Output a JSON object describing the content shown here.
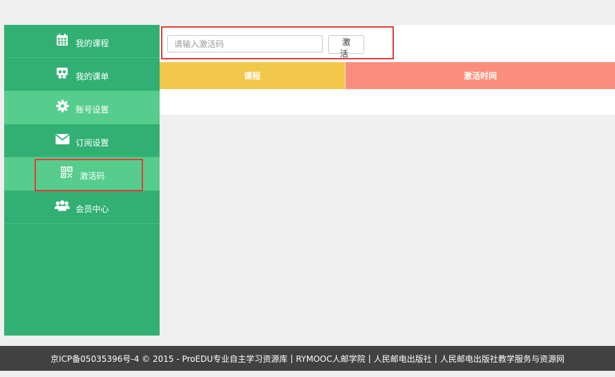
{
  "sidebar": {
    "items": [
      {
        "label": "我的课程",
        "icon": "calendar-icon"
      },
      {
        "label": "我的课单",
        "icon": "course-list-icon"
      },
      {
        "label": "账号设置",
        "icon": "gear-icon"
      },
      {
        "label": "订阅设置",
        "icon": "envelope-icon"
      },
      {
        "label": "激活码",
        "icon": "qrcode-icon"
      },
      {
        "label": "会员中心",
        "icon": "users-icon"
      }
    ]
  },
  "activation": {
    "placeholder": "请输入激活码",
    "value": "",
    "button_label": "激 活"
  },
  "table": {
    "headers": [
      "课程",
      "激活时间"
    ],
    "rows": []
  },
  "footer": {
    "icp": "京ICP备05035396号-4",
    "copyright": "© 2015 - ProEDU专业自主学习资源库",
    "links": [
      "RYMOOC人邮学院",
      "人民邮电出版社",
      "人民邮电出版社教学服务与资源网"
    ],
    "separator": "|"
  },
  "colors": {
    "sidebar": "#32b074",
    "sidebar_active": "#56cc8d",
    "header_course": "#f2c84b",
    "header_time": "#fb8d7c",
    "highlight": "#e53935",
    "footer": "#414141"
  }
}
